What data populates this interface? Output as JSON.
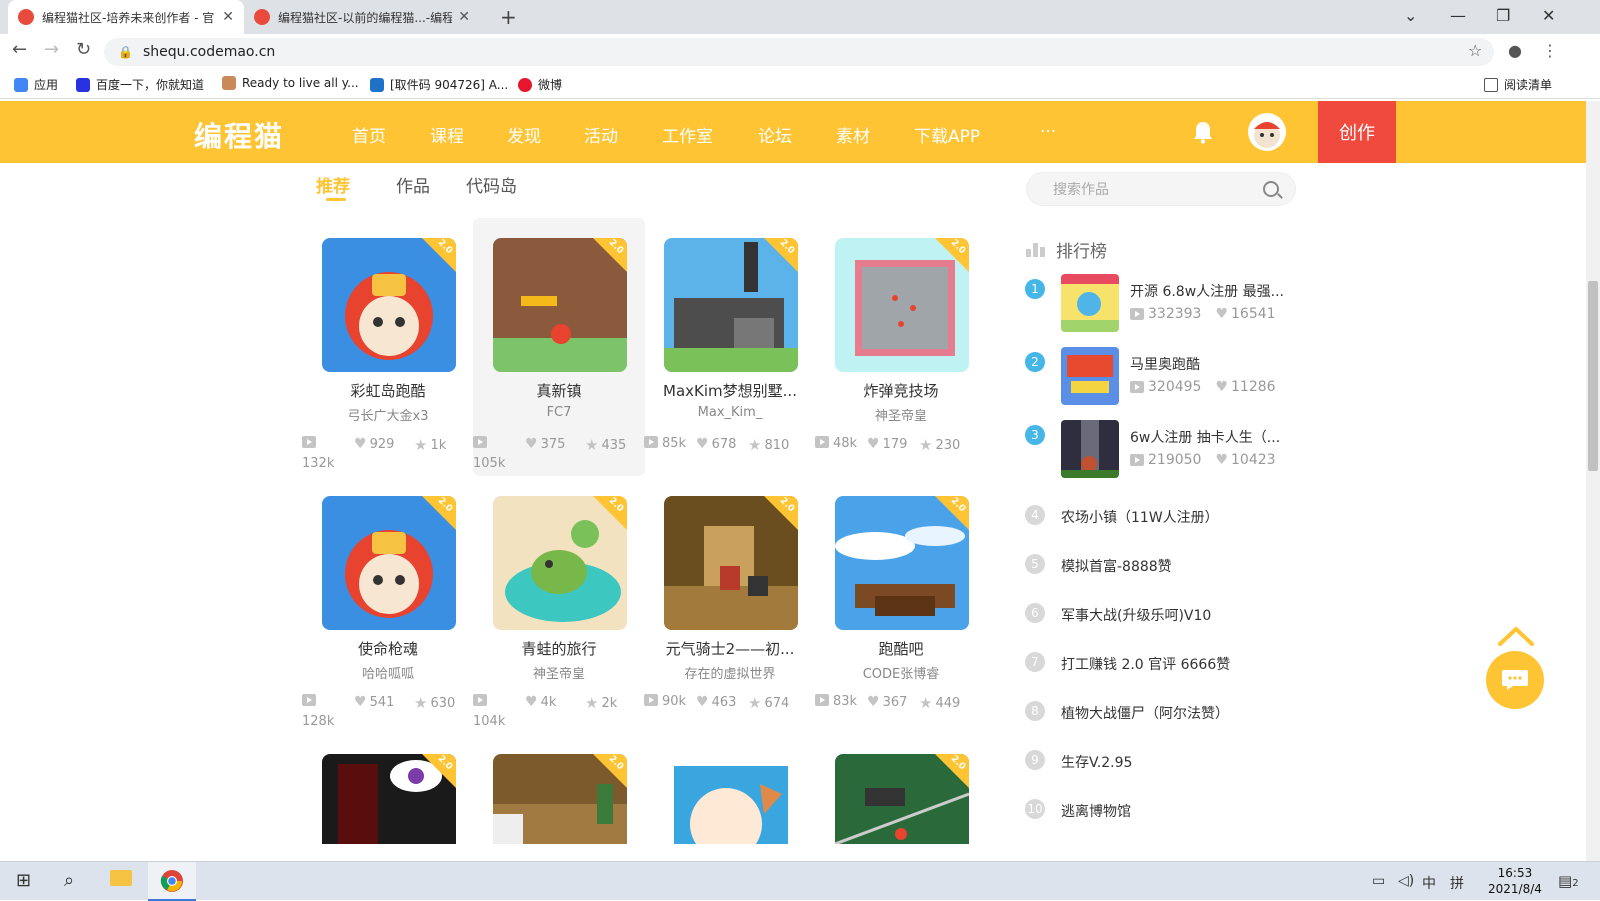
{
  "browser": {
    "tabs": [
      {
        "title": "编程猫社区-培养未来创作者 - 官",
        "active": true
      },
      {
        "title": "编程猫社区-以前的编程猫...-编程",
        "active": false
      }
    ],
    "url": "shequ.codemao.cn",
    "bookmarks": [
      "应用",
      "百度一下，你就知道",
      "Ready to live all y...",
      "[取件码 904726] A...",
      "微博"
    ],
    "reading_list": "阅读清单"
  },
  "site": {
    "logo": "编程猫",
    "nav": [
      "首页",
      "课程",
      "发现",
      "活动",
      "工作室",
      "论坛",
      "素材",
      "下载APP",
      "···"
    ],
    "create_label": "创作",
    "accent_color": "#fec433",
    "create_color": "#f04a3f"
  },
  "subtabs": [
    "推荐",
    "作品",
    "代码岛"
  ],
  "works": [
    {
      "name": "彩虹岛跑酷",
      "author": "弓长广大金x3",
      "views": "132k",
      "likes": "929",
      "stars": "1k"
    },
    {
      "name": "真新镇",
      "author": "FC7",
      "views": "105k",
      "likes": "375",
      "stars": "435"
    },
    {
      "name": "MaxKim梦想别墅...",
      "author": "Max_Kim_",
      "views": "85k",
      "likes": "678",
      "stars": "810"
    },
    {
      "name": "炸弹竞技场",
      "author": "神圣帝皇",
      "views": "48k",
      "likes": "179",
      "stars": "230"
    },
    {
      "name": "使命枪魂",
      "author": "哈哈呱呱",
      "views": "128k",
      "likes": "541",
      "stars": "630"
    },
    {
      "name": "青蛙的旅行",
      "author": "神圣帝皇",
      "views": "104k",
      "likes": "4k",
      "stars": "2k"
    },
    {
      "name": "元气骑士2——初...",
      "author": "存在的虚拟世界",
      "views": "90k",
      "likes": "463",
      "stars": "674"
    },
    {
      "name": "跑酷吧",
      "author": "CODE张博睿",
      "views": "83k",
      "likes": "367",
      "stars": "449"
    }
  ],
  "badge_text": "2.0",
  "search_placeholder": "搜索作品",
  "ranking": {
    "title": "排行榜",
    "top": [
      {
        "rank": "1",
        "name": "开源 6.8w人注册 最强...",
        "views": "332393",
        "likes": "16541"
      },
      {
        "rank": "2",
        "name": "马里奥跑酷",
        "views": "320495",
        "likes": "11286"
      },
      {
        "rank": "3",
        "name": "6w人注册 抽卡人生（...",
        "views": "219050",
        "likes": "10423"
      }
    ],
    "rest": [
      {
        "rank": "4",
        "name": "农场小镇（11W人注册）"
      },
      {
        "rank": "5",
        "name": "模拟首富-8888赞"
      },
      {
        "rank": "6",
        "name": "军事大战(升级乐呵)V10"
      },
      {
        "rank": "7",
        "name": "打工赚钱 2.0 官评 6666赞"
      },
      {
        "rank": "8",
        "name": "植物大战僵尸（阿尔法赞）"
      },
      {
        "rank": "9",
        "name": "生存V.2.95"
      },
      {
        "rank": "10",
        "name": "逃离博物馆"
      }
    ]
  },
  "taskbar": {
    "time": "16:53",
    "date": "2021/8/4",
    "ime": "中",
    "ime2": "拼",
    "notifications": "2"
  }
}
